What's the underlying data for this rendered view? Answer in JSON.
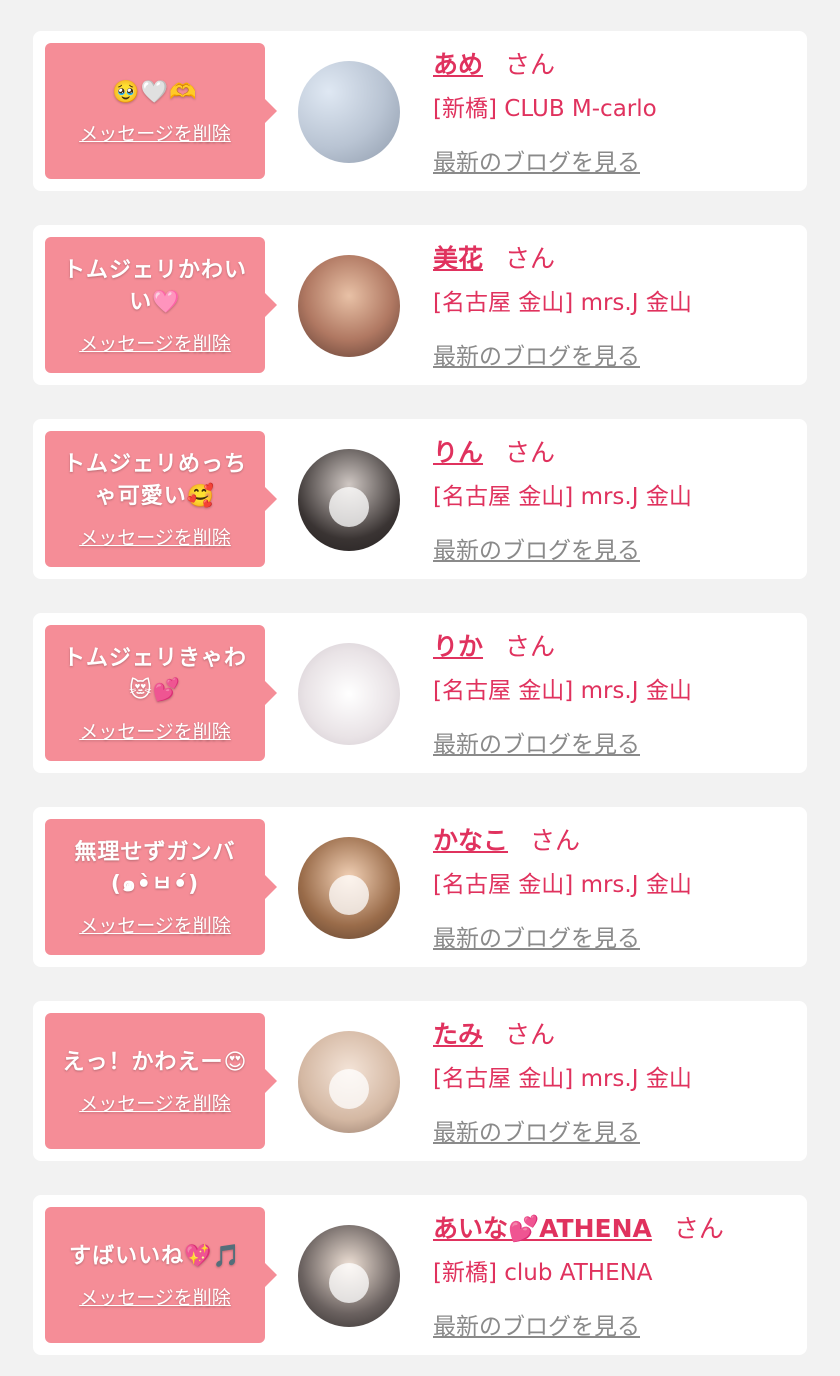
{
  "messages": [
    {
      "text": "",
      "emoji": "🥹🤍🫶",
      "delete_label": "メッセージを削除",
      "name": "あめ",
      "honorific": "さん",
      "shop": "[新橋] CLUB M-carlo",
      "blog_link": "最新のブログを見る"
    },
    {
      "text": "トムジェリかわいい",
      "emoji": "🩷",
      "delete_label": "メッセージを削除",
      "name": "美花",
      "honorific": "さん",
      "shop": "[名古屋 金山] mrs.J 金山",
      "blog_link": "最新のブログを見る"
    },
    {
      "text": "トムジェリめっちゃ可愛い",
      "emoji": "🥰",
      "delete_label": "メッセージを削除",
      "name": "りん",
      "honorific": "さん",
      "shop": "[名古屋 金山] mrs.J 金山",
      "blog_link": "最新のブログを見る"
    },
    {
      "text": "トムジェリきゃわ",
      "emoji": "😻💕",
      "delete_label": "メッセージを削除",
      "name": "りか",
      "honorific": "さん",
      "shop": "[名古屋 金山] mrs.J 金山",
      "blog_link": "最新のブログを見る"
    },
    {
      "text": "無理せずガンバ(๑•̀ㅂ•́)",
      "emoji": "",
      "delete_label": "メッセージを削除",
      "name": "かなこ",
      "honorific": "さん",
      "shop": "[名古屋 金山] mrs.J 金山",
      "blog_link": "最新のブログを見る"
    },
    {
      "text": "えっ！かわえー",
      "emoji": "😍",
      "delete_label": "メッセージを削除",
      "name": "たみ",
      "honorific": "さん",
      "shop": "[名古屋 金山] mrs.J 金山",
      "blog_link": "最新のブログを見る"
    },
    {
      "text": "すばいいね",
      "emoji": "💖🎵",
      "delete_label": "メッセージを削除",
      "name": "あいな💕ATHENA",
      "honorific": "さん",
      "shop": "[新橋] club ATHENA",
      "blog_link": "最新のブログを見る"
    }
  ],
  "colors": {
    "page_background": "#f2f2f2",
    "card_background": "#ffffff",
    "bubble": "#f58d97",
    "accent_text": "#e0325e",
    "link_gray": "#8a8a8a"
  }
}
